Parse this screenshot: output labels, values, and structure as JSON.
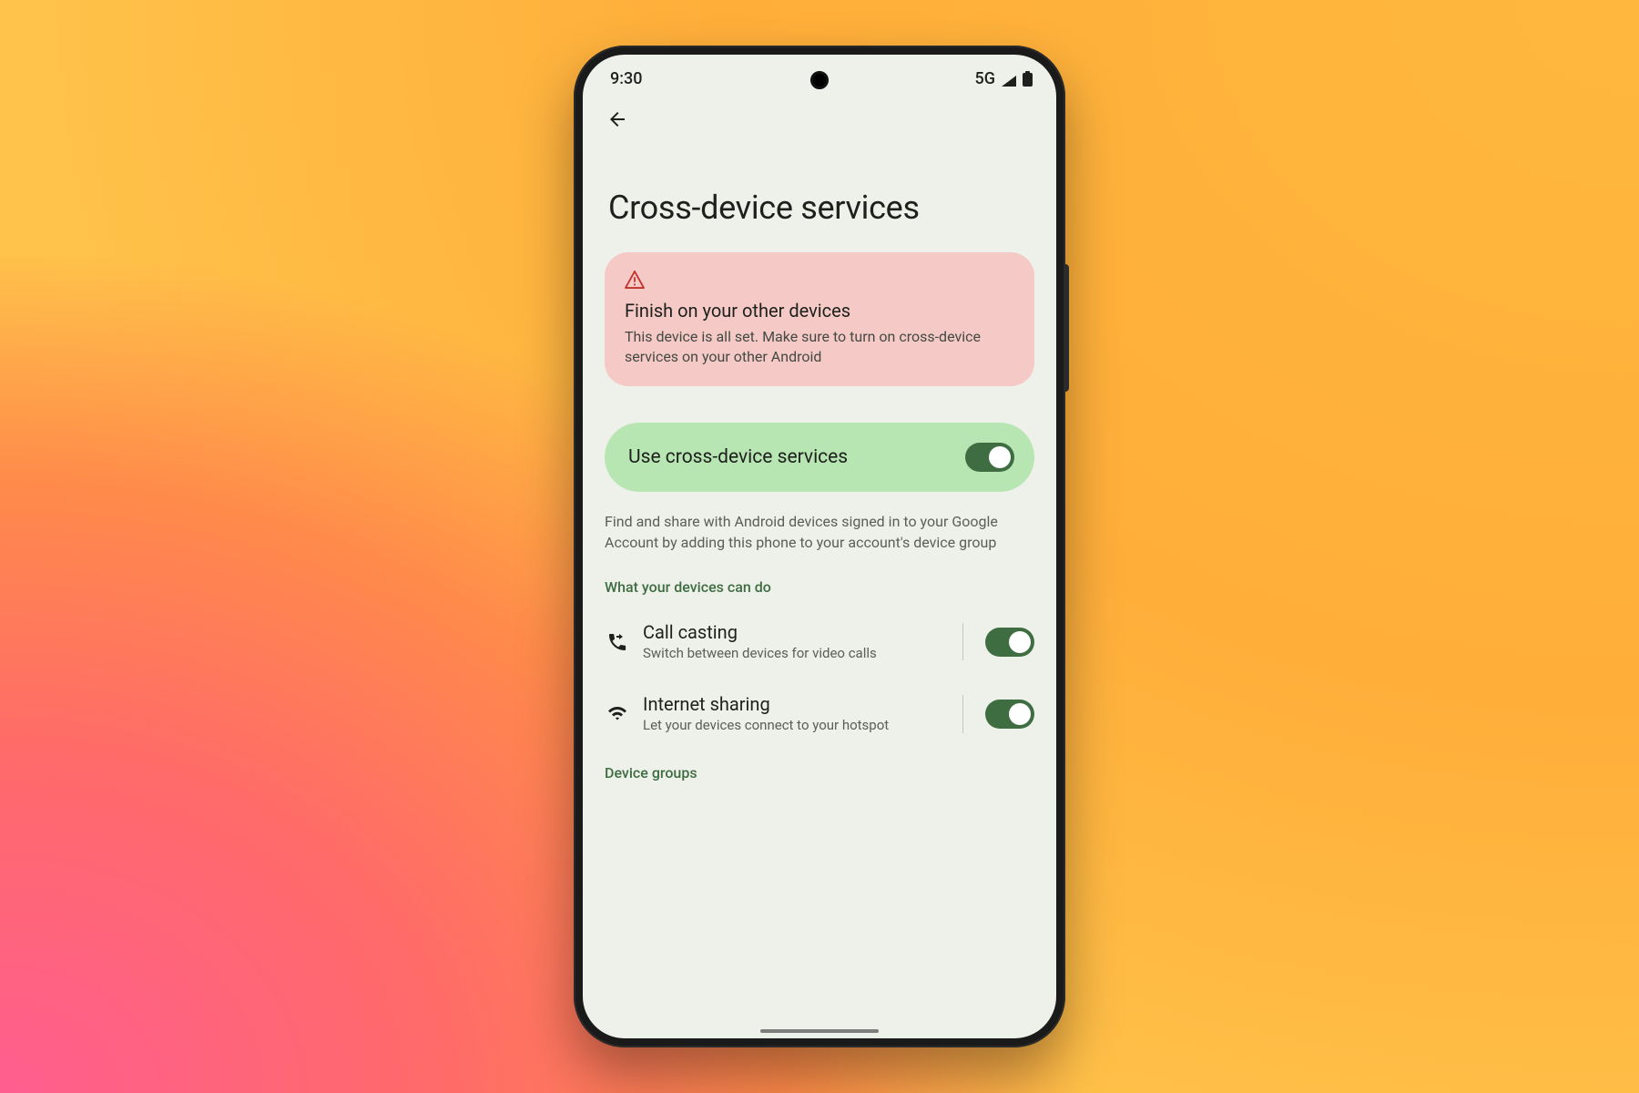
{
  "status": {
    "time": "9:30",
    "network": "5G"
  },
  "page": {
    "title": "Cross-device services"
  },
  "alert": {
    "title": "Finish on your other devices",
    "body": "This device is all set. Make sure to turn on cross-device services on your other Android"
  },
  "master": {
    "label": "Use cross-device services",
    "enabled": true
  },
  "helper": "Find and share with Android devices signed in to your Google Account by adding this phone to your account's device group",
  "section_header": "What your devices can do",
  "features": [
    {
      "icon": "phone-forwarded-icon",
      "title": "Call casting",
      "subtitle": "Switch between devices for video calls",
      "enabled": true
    },
    {
      "icon": "wifi-icon",
      "title": "Internet sharing",
      "subtitle": "Let your devices connect to your hotspot",
      "enabled": true
    }
  ],
  "link": "Device groups"
}
